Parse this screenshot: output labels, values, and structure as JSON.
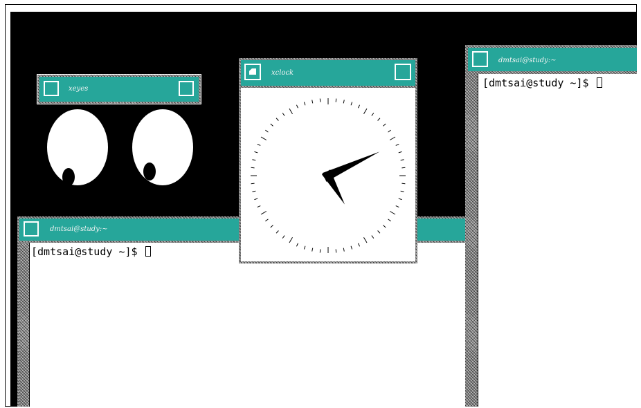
{
  "desktop": {
    "background_color": "#000000",
    "accent_color": "#26a69a"
  },
  "xeyes": {
    "title": "xeyes",
    "pupil_direction": "down-left"
  },
  "xclock": {
    "title": "xclock",
    "hour_hand_angle_deg": 150,
    "minute_hand_angle_deg": 65
  },
  "terminal_left": {
    "title": "dmtsai@study:~",
    "prompt": "[dmtsai@study ~]$ "
  },
  "terminal_right": {
    "title": "dmtsai@study:~",
    "prompt": "[dmtsai@study ~]$ "
  }
}
